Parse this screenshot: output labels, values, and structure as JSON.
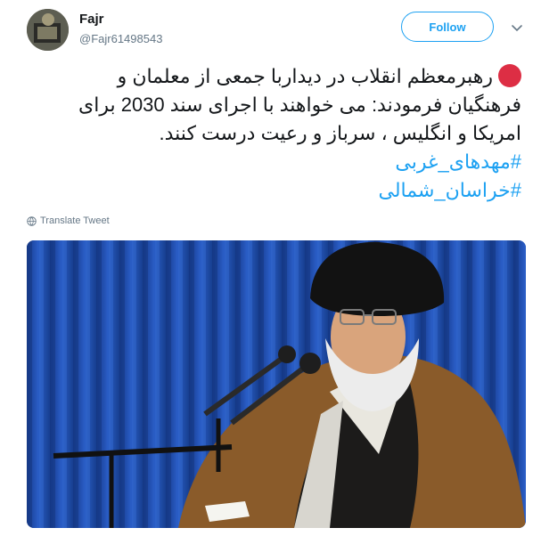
{
  "author": {
    "display_name": "Fajr",
    "handle": "@Fajr61498543"
  },
  "follow": {
    "label": "Follow"
  },
  "tweet": {
    "lines": [
      "رهبرمعظم انقلاب در دیداربا جمعی از معلمان و",
      "فرهنگیان فرمودند: می خواهند با اجرای سند 2030 برای",
      "امریکا و انگلیس ، سرباز و رعیت درست کنند."
    ],
    "hashtags": [
      "#مهدهای_غربی",
      "#خراسان_شمالی"
    ]
  },
  "translate": {
    "label": "Translate Tweet"
  },
  "colors": {
    "accent": "#1da1f2",
    "dot": "#dd2e44",
    "text": "#14171a",
    "muted": "#657786"
  },
  "icons": [
    "avatar",
    "chevron-down-icon",
    "red-circle-icon",
    "globe-icon"
  ]
}
